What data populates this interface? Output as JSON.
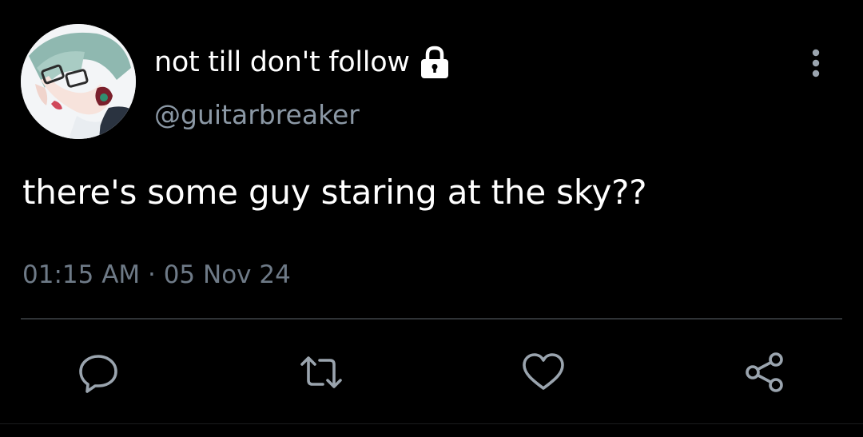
{
  "tweet": {
    "display_name": "not till don't follow",
    "handle": "@guitarbreaker",
    "text": "there's some guy staring at the sky??",
    "timestamp": "01:15 AM · 05 Nov 24",
    "protected": true,
    "icons": {
      "lock": "lock-icon",
      "more": "more-vertical-icon",
      "reply": "reply-icon",
      "retweet": "retweet-icon",
      "like": "heart-icon",
      "share": "share-icon"
    }
  },
  "colors": {
    "background": "#000000",
    "text_primary": "#ffffff",
    "text_secondary": "#8b98a5",
    "icon": "#9aa4ae",
    "divider": "#2f3336"
  }
}
